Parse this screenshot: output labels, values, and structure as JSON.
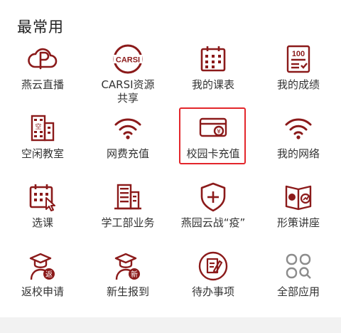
{
  "section": {
    "title": "最常用"
  },
  "colors": {
    "brand": "#8b1a1a",
    "highlight": "#e3262b",
    "grey_icon": "#8c8c8c"
  },
  "items": [
    {
      "label": "燕云直播",
      "icon": "cloud-play-icon"
    },
    {
      "label": "CARSI资源共享",
      "icon": "carsi-icon"
    },
    {
      "label": "我的课表",
      "icon": "calendar-icon"
    },
    {
      "label": "我的成绩",
      "icon": "score-icon"
    },
    {
      "label": "空闲教室",
      "icon": "building-icon"
    },
    {
      "label": "网费充值",
      "icon": "wifi-icon"
    },
    {
      "label": "校园卡充值",
      "icon": "card-yuan-icon"
    },
    {
      "label": "我的网络",
      "icon": "wifi-icon"
    },
    {
      "label": "选课",
      "icon": "calendar-select-icon"
    },
    {
      "label": "学工部业务",
      "icon": "office-building-icon"
    },
    {
      "label": "燕园云战“疫”",
      "icon": "shield-plus-icon"
    },
    {
      "label": "形策讲座",
      "icon": "book-emblem-icon"
    },
    {
      "label": "返校申请",
      "icon": "graduate-return-icon"
    },
    {
      "label": "新生报到",
      "icon": "graduate-new-icon"
    },
    {
      "label": "待办事项",
      "icon": "todo-edit-icon"
    },
    {
      "label": "全部应用",
      "icon": "all-apps-icon"
    }
  ]
}
